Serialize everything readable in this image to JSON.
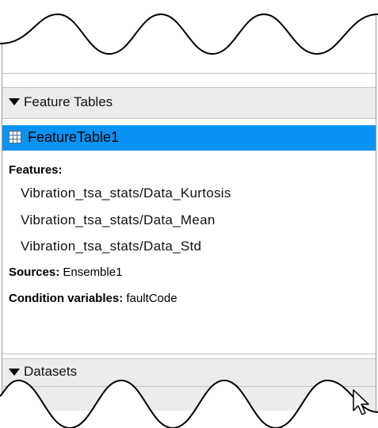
{
  "feature_tables": {
    "header_label": "Feature Tables",
    "selected_table": "FeatureTable1",
    "features_label": "Features:",
    "features": [
      "Vibration_tsa_stats/Data_Kurtosis",
      "Vibration_tsa_stats/Data_Mean",
      "Vibration_tsa_stats/Data_Std"
    ],
    "sources_label": "Sources:",
    "sources_value": "Ensemble1",
    "condition_label": "Condition variables:",
    "condition_value": "faultCode"
  },
  "datasets": {
    "header_label": "Datasets",
    "first_item_partial": "1"
  },
  "colors": {
    "selection": "#0a93f5",
    "header_bg": "#ececec"
  },
  "icons": {
    "collapse": "triangle-down-icon",
    "table": "table-grid-icon",
    "cursor": "mouse-pointer-icon"
  }
}
